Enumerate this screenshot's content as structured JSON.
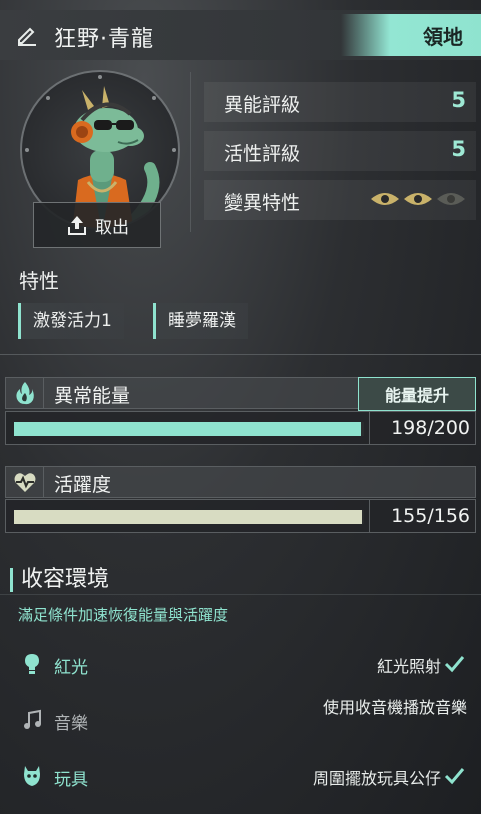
{
  "header": {
    "title": "狂野·青龍",
    "territory_button": "領地"
  },
  "portrait": {
    "release_label": "取出"
  },
  "stats": [
    {
      "label": "異能評級",
      "value": "5"
    },
    {
      "label": "活性評級",
      "value": "5"
    },
    {
      "label": "變異特性",
      "eyes_active": 2,
      "eyes_total": 3
    }
  ],
  "traits": {
    "label": "特性",
    "tags": [
      "激發活力1",
      "睡夢羅漢"
    ]
  },
  "energy": {
    "title": "異常能量",
    "boost_button": "能量提升",
    "value_text": "198/200",
    "current": 198,
    "max": 200,
    "color": "#8fe3cf"
  },
  "activity": {
    "title": "活躍度",
    "value_text": "155/156",
    "current": 155,
    "max": 156,
    "color": "#d8dcc2"
  },
  "containment": {
    "title": "收容環境",
    "subtitle": "滿足條件加速恢復能量與活躍度",
    "items": [
      {
        "name": "紅光",
        "condition": "紅光照射",
        "met": true,
        "icon": "lightbulb-icon"
      },
      {
        "name": "音樂",
        "condition": "使用收音機播放音樂",
        "met": false,
        "icon": "music-note-icon"
      },
      {
        "name": "玩具",
        "condition": "周圍擺放玩具公仔",
        "met": true,
        "icon": "toy-icon"
      }
    ]
  },
  "colors": {
    "accent": "#8fe3cf",
    "activity_bar": "#d8dcc2",
    "eye_active": "#c9b26a",
    "eye_inactive": "#5a5c57"
  }
}
